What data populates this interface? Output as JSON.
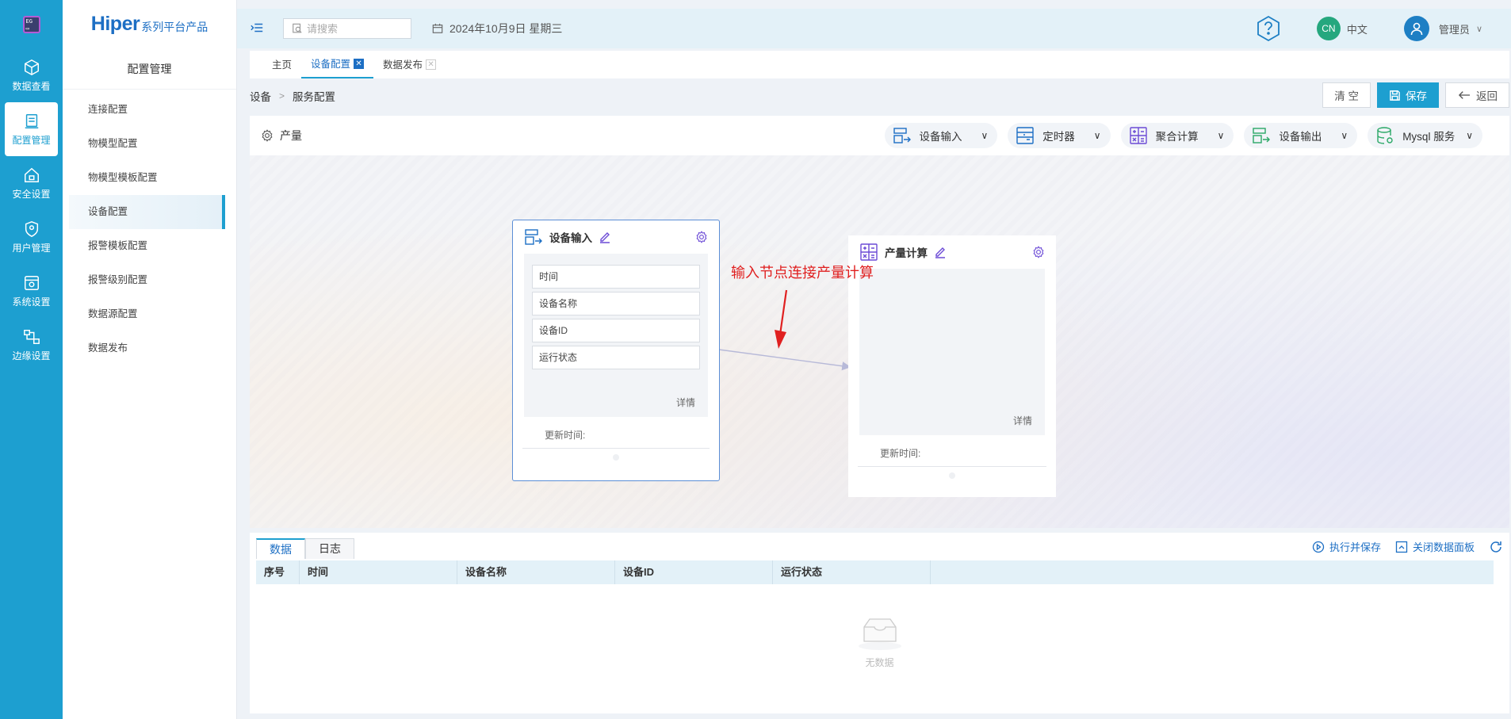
{
  "rail": {
    "logo_text": "EG",
    "items": [
      {
        "label": "数据查看",
        "icon": "cube-icon"
      },
      {
        "label": "配置管理",
        "icon": "config-doc-icon",
        "active": true
      },
      {
        "label": "安全设置",
        "icon": "home-lock-icon"
      },
      {
        "label": "用户管理",
        "icon": "shield-user-icon"
      },
      {
        "label": "系统设置",
        "icon": "system-gear-icon"
      },
      {
        "label": "边缘设置",
        "icon": "edge-network-icon"
      }
    ]
  },
  "brand": {
    "main": "Hiper",
    "sub": "系列平台产品"
  },
  "sidebar": {
    "title": "配置管理",
    "items": [
      {
        "label": "连接配置"
      },
      {
        "label": "物模型配置"
      },
      {
        "label": "物模型模板配置"
      },
      {
        "label": "设备配置",
        "active": true
      },
      {
        "label": "报警模板配置"
      },
      {
        "label": "报警级别配置"
      },
      {
        "label": "数据源配置"
      },
      {
        "label": "数据发布"
      }
    ]
  },
  "topbar": {
    "search_placeholder": "请搜索",
    "date": "2024年10月9日 星期三",
    "lang_badge": "CN",
    "lang_label": "中文",
    "user_label": "管理员"
  },
  "tabs": [
    {
      "label": "主页"
    },
    {
      "label": "设备配置",
      "active": true
    },
    {
      "label": "数据发布"
    }
  ],
  "breadcrumb": {
    "root": "设备",
    "current": "服务配置"
  },
  "actions": {
    "clear": "清 空",
    "save": "保存",
    "back": "返回"
  },
  "toolbar": {
    "title": "产量",
    "tools": [
      {
        "label": "设备输入",
        "icon": "device-input-icon"
      },
      {
        "label": "定时器",
        "icon": "timer-icon"
      },
      {
        "label": "聚合计算",
        "icon": "calc-icon"
      },
      {
        "label": "设备输出",
        "icon": "device-output-icon"
      },
      {
        "label": "Mysql 服务",
        "icon": "database-icon"
      }
    ]
  },
  "nodes": {
    "input": {
      "title": "设备输入",
      "fields": [
        "时间",
        "设备名称",
        "设备ID",
        "运行状态"
      ],
      "detail": "详情",
      "updated": "更新时间:"
    },
    "calc": {
      "title": "产量计算",
      "detail": "详情",
      "updated": "更新时间:"
    }
  },
  "annotation": "输入节点连接产量计算",
  "panel": {
    "tabs": [
      {
        "label": "数据",
        "active": true
      },
      {
        "label": "日志"
      }
    ],
    "tools": {
      "run": "执行并保存",
      "close": "关闭数据面板"
    },
    "columns": [
      "序号",
      "时间",
      "设备名称",
      "设备ID",
      "运行状态"
    ],
    "empty_text": "无数据"
  },
  "colors": {
    "accent": "#1d9fd0",
    "brand": "#1d6fc4",
    "annotation": "#e02020"
  }
}
